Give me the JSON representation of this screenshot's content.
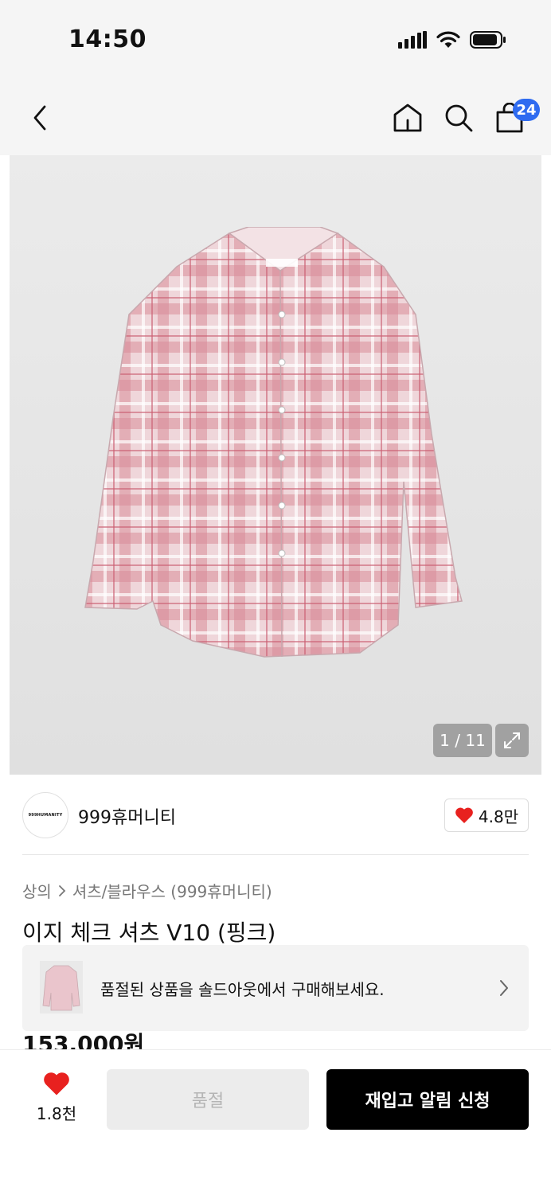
{
  "status_bar": {
    "time": "14:50"
  },
  "nav": {
    "cart_count": "24"
  },
  "gallery": {
    "counter": "1 / 11"
  },
  "brand": {
    "logo_text": "999HUMANITY",
    "name": "999휴머니티",
    "likes": "4.8만"
  },
  "breadcrumb": {
    "category": "상의",
    "subcategory": "셔츠/블라우스 (999휴머니티)"
  },
  "product": {
    "title": "이지 체크 셔츠 V10 (핑크)",
    "price": "153,000원"
  },
  "soldout_banner": {
    "text": "품절된 상품을 솔드아웃에서 구매해보세요."
  },
  "bottom_bar": {
    "wish_count": "1.8천",
    "soldout_label": "품절",
    "restock_label": "재입고 알림 신청"
  },
  "colors": {
    "accent_blue": "#2f6bf0",
    "heart_red": "#e8211f",
    "cta_black": "#000000"
  }
}
